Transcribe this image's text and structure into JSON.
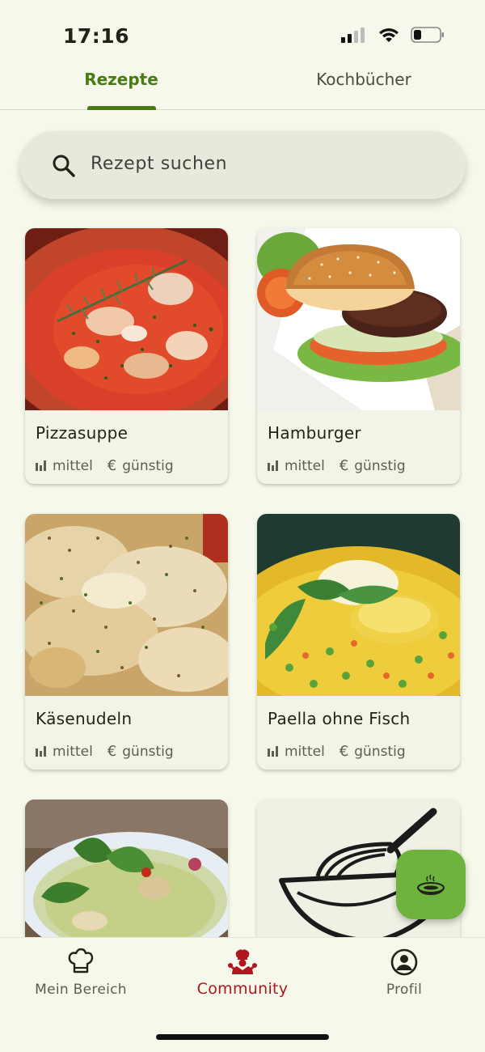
{
  "status": {
    "time": "17:16"
  },
  "tabs": [
    {
      "label": "Rezepte",
      "active": true
    },
    {
      "label": "Kochbücher",
      "active": false
    }
  ],
  "search": {
    "placeholder": "Rezept suchen"
  },
  "recipes": [
    {
      "title": "Pizzasuppe",
      "difficulty": "mittel",
      "price": "günstig"
    },
    {
      "title": "Hamburger",
      "difficulty": "mittel",
      "price": "günstig"
    },
    {
      "title": "Käsenudeln",
      "difficulty": "mittel",
      "price": "günstig"
    },
    {
      "title": "Paella ohne Fisch",
      "difficulty": "mittel",
      "price": "günstig"
    }
  ],
  "price_symbol": "€",
  "bottom_nav": [
    {
      "label": "Mein Bereich",
      "icon": "chef-hat-icon",
      "active": false
    },
    {
      "label": "Community",
      "icon": "community-chef-icon",
      "active": true
    },
    {
      "label": "Profil",
      "icon": "profile-icon",
      "active": false
    }
  ],
  "colors": {
    "background": "#f5f8ea",
    "accent": "#4a7a12",
    "fab": "#6eb33e",
    "active_nav": "#b0161e"
  }
}
